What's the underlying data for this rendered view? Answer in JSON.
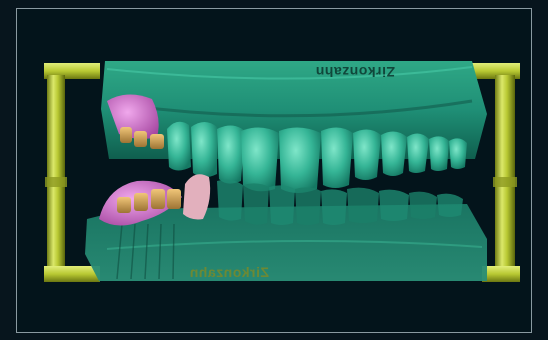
{
  "viewport": {
    "upper_model_label": "Zirkonzahn",
    "lower_model_label": "Zirkonzahn"
  },
  "colors": {
    "background": "#07151d",
    "viewport_border": "#8a9aa1",
    "model": "#1f8f76",
    "model_light": "#44c4a6",
    "articulator": "#b9c933",
    "gingiva": "#c872c4",
    "prep_gold": "#c9a157",
    "crown_pink": "#e2b0bd"
  }
}
